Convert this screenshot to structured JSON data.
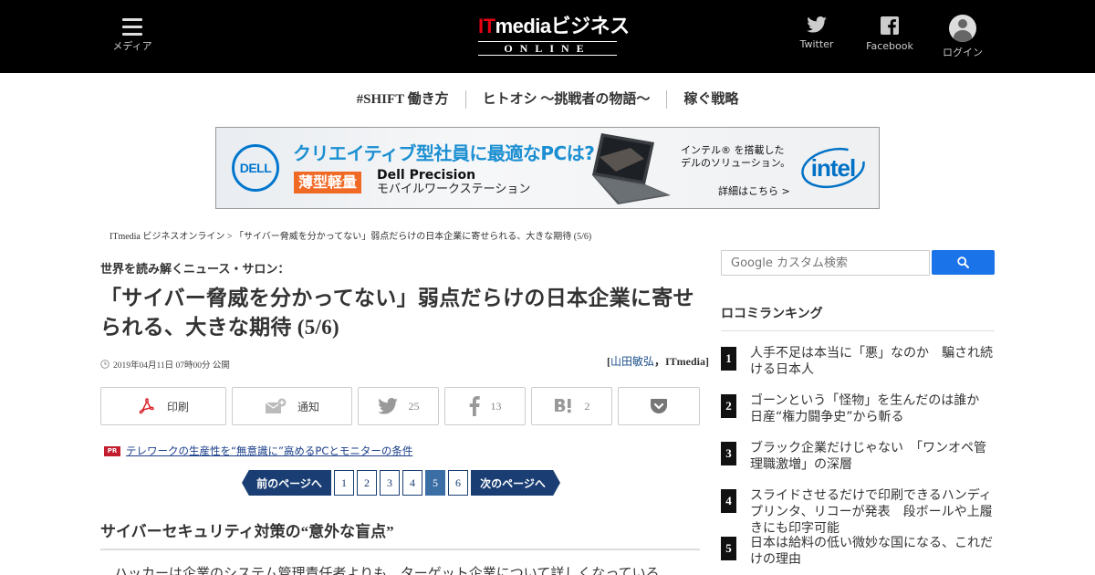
{
  "header": {
    "menu_label": "メディア",
    "logo_top_it": "IT",
    "logo_top_rest": "mediaビジネス",
    "logo_bottom": "ONLINE",
    "twitter_label": "Twitter",
    "facebook_label": "Facebook",
    "login_label": "ログイン"
  },
  "nav": {
    "items": [
      {
        "label": "#SHIFT 働き方"
      },
      {
        "label": "ヒトオシ ～挑戦者の物語～"
      },
      {
        "label": "稼ぐ戦略"
      }
    ]
  },
  "ad": {
    "dell_logo": "DELL",
    "headline": "クリエイティブ型社員に最適なPCは?",
    "badge": "薄型軽量",
    "product_line1": "Dell Precision",
    "product_line2": "モバイルワークステーション",
    "right_line1": "インテル® を搭載した",
    "right_line2": "デルのソリューション。",
    "more": "詳細はこちら >",
    "intel_logo": "intel"
  },
  "breadcrumb": "ITmedia ビジネスオンライン > 「サイバー脅威を分かってない」弱点だらけの日本企業に寄せられる、大きな期待 (5/6)",
  "article": {
    "kicker": "世界を読み解くニュース・サロン：",
    "title": "「サイバー脅威を分かってない」弱点だらけの日本企業に寄せられる、大きな期待 (5/6)",
    "date": "2019年04月11日 07時00分 公開",
    "byline_open": "[",
    "author": "山田敏弘",
    "byline_rest": "，ITmedia]",
    "share": {
      "print_label": "印刷",
      "notify_label": "通知",
      "twitter_count": "25",
      "facebook_count": "13",
      "hatena_count": "2"
    },
    "pr_badge": "PR",
    "pr_link": "テレワークの生産性を“無意識に”高めるPCとモニターの条件",
    "pager": {
      "prev": "前のページへ",
      "next": "次のページへ",
      "pages": [
        "1",
        "2",
        "3",
        "4",
        "5",
        "6"
      ],
      "current": "5"
    },
    "section_heading": "サイバーセキュリティ対策の“意外な盲点”",
    "body_first_line": "　ハッカーは企業のシステム管理責任者よりも、ターゲット企業について詳しくなっている"
  },
  "sidebar": {
    "search_placeholder": "Google カスタム検索",
    "ranking_title": "ロコミランキング",
    "ranking": [
      {
        "num": "1",
        "text": "人手不足は本当に「悪」なのか　騙され続ける日本人"
      },
      {
        "num": "2",
        "text": "ゴーンという「怪物」を生んだのは誰か　日産“権力闘争史”から斬る"
      },
      {
        "num": "3",
        "text": "ブラック企業だけじゃない　「ワンオペ管理職激増」の深層"
      },
      {
        "num": "4",
        "text": "スライドさせるだけで印刷できるハンディプリンタ、リコーが発表　段ボールや上履きにも印字可能"
      },
      {
        "num": "5",
        "text": "日本は給料の低い微妙な国になる、これだけの理由"
      }
    ]
  },
  "colors": {
    "header_bg": "#000000",
    "accent_blue": "#1a3e73",
    "logo_red": "#e60012",
    "dell_blue": "#0076ce",
    "intel_blue": "#0071c5"
  }
}
